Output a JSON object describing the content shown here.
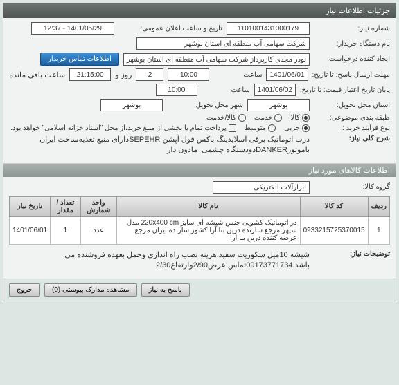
{
  "title_bar": "جزئیات اطلاعات نیاز",
  "fields": {
    "need_no_label": "شماره نیاز:",
    "need_no": "1101001431000179",
    "announce_label": "تاریخ و ساعت اعلان عمومی:",
    "announce": "1401/05/29 - 12:37",
    "buyer_label": "نام دستگاه خریدار:",
    "buyer": "شرکت سهامی آب منطقه ای استان بوشهر",
    "creator_label": "ایجاد کننده درخواست:",
    "creator": "نوذر مجدی کارپرداز شرکت سهامی آب منطقه ای استان بوشهر",
    "contact_btn": "اطلاعات تماس خریدار",
    "deadline_label": "مهلت ارسال پاسخ: تا تاریخ:",
    "deadline_date": "1401/06/01",
    "time_label": "ساعت",
    "deadline_time": "10:00",
    "day_label": "روز و",
    "days": "2",
    "remain_time": "21:15:00",
    "remain_label": "ساعت باقی مانده",
    "validity_label": "پایان تاریخ اعتبار قیمت: تا تاریخ:",
    "validity_date": "1401/06/02",
    "validity_time": "10:00",
    "province_label": "استان محل تحویل:",
    "province": "بوشهر",
    "city_label": "شهر محل تحویل:",
    "city": "بوشهر",
    "category_label": "طبقه بندی موضوعی:",
    "cat_goods": "کالا",
    "cat_service": "خدمت",
    "cat_both": "کالا/خدمت",
    "process_label": "نوع فرآیند خرید :",
    "proc_small": "جزیی",
    "proc_medium": "متوسط",
    "proc_note": "پرداخت تمام یا بخشی از مبلغ خرید،از محل \"اسناد خزانه اسلامی\" خواهد بود.",
    "desc_label": "شرح کلی نیاز:",
    "desc": "درب اتوماتیک برقی اسلایدینگ باکس فول آپشن SEPEHRدارای منبع تغذیه‌ساخت ایران باموتورDANKERدودستگاه چشمی  مادون دار"
  },
  "section2": "اطلاعات کالاهای مورد نیاز",
  "group_label": "گروه کالا:",
  "group_value": "ابزارآلات الکتریکی",
  "table": {
    "headers": [
      "ردیف",
      "کد کالا",
      "نام کالا",
      "واحد شمارش",
      "تعداد / مقدار",
      "تاریخ نیاز"
    ],
    "row": {
      "n": "1",
      "code": "0933215725370015",
      "name": "در اتوماتیک کشویی جنس شیشه ای سایز 220x400 cm مدل سپهر مرجع سازنده درین بنا آرا کشور سازنده ایران مرجع عرضه کننده درین بنا آرا",
      "unit": "عدد",
      "qty": "1",
      "date": "1401/06/01"
    }
  },
  "notes_label": "توضیحات نیاز:",
  "notes": "شیشه 10میل سکوریت سفید.هزینه نصب راه اندازی وحمل بعهده فروشنده می باشد.09173771734تماس عرض2/90وارتفاع2/30",
  "footer": {
    "reply": "پاسخ به نیاز",
    "attach": "مشاهده مدارک پیوستی (0)",
    "exit": "خروج"
  }
}
